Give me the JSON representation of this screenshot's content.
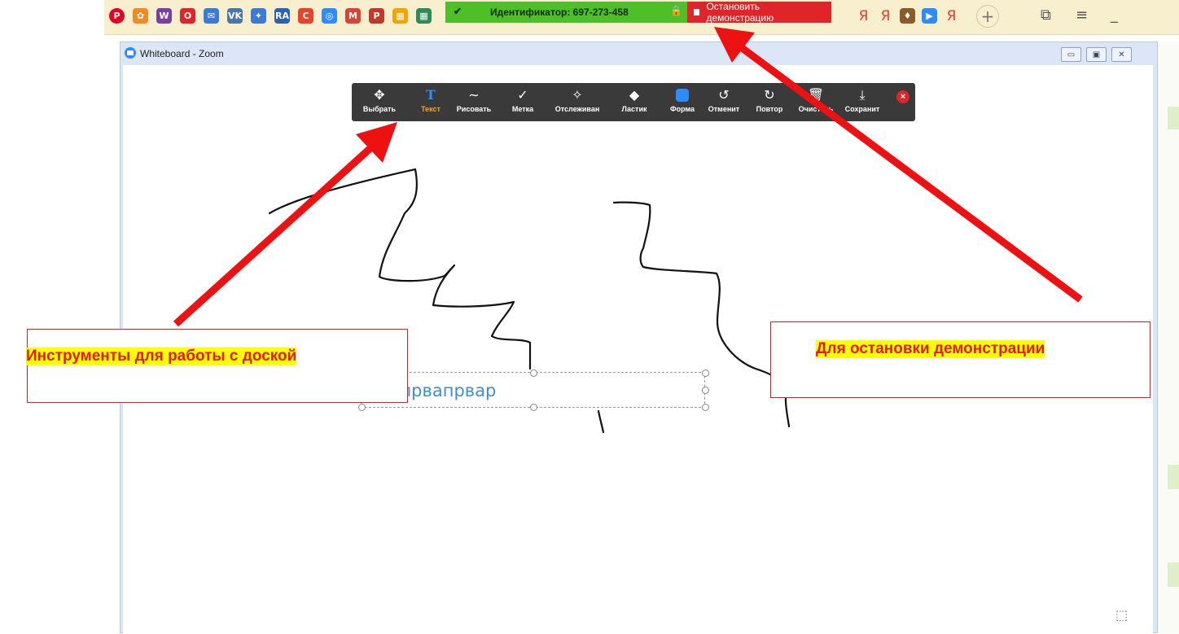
{
  "browser": {
    "bookmarks": [
      {
        "name": "pinterest-icon",
        "glyph": "P",
        "color": "#e60023",
        "round": true
      },
      {
        "name": "fish-icon",
        "glyph": "✿",
        "color": "#f08a24"
      },
      {
        "name": "w-bookmark-icon",
        "glyph": "W",
        "color": "#7b3fa0"
      },
      {
        "name": "o-bookmark-icon",
        "glyph": "O",
        "color": "#e0252a"
      },
      {
        "name": "vk-mail-icon",
        "glyph": "✉",
        "color": "#3a7bd5"
      },
      {
        "name": "vk-icon",
        "glyph": "VK",
        "color": "#4a76a8"
      },
      {
        "name": "puzzle-icon",
        "glyph": "✦",
        "color": "#3a7bd5"
      },
      {
        "name": "ra-icon",
        "glyph": "RA",
        "color": "#2a63b8"
      },
      {
        "name": "c-bookmark-icon",
        "glyph": "C",
        "color": "#e8412c"
      },
      {
        "name": "circle-icon",
        "glyph": "◎",
        "color": "#2d8cff"
      },
      {
        "name": "gmail-icon",
        "glyph": "M",
        "color": "#d44638"
      },
      {
        "name": "pdf-icon",
        "glyph": "P",
        "color": "#c0392b"
      },
      {
        "name": "grid-icon",
        "glyph": "▦",
        "color": "#f0a500"
      },
      {
        "name": "windows-icon",
        "glyph": "▦",
        "color": "#2e8b57"
      }
    ],
    "bookmarks_right": [
      {
        "name": "yandex-icon-1",
        "glyph": "Я"
      },
      {
        "name": "yandex-icon-2",
        "glyph": "Я"
      },
      {
        "name": "bird-icon",
        "glyph": "♦",
        "color": "#8a5a2b"
      },
      {
        "name": "zoom-bookmark-icon",
        "glyph": "▶",
        "color": "#2d8cff"
      },
      {
        "name": "yandex-icon-3",
        "glyph": "Я"
      }
    ],
    "plus": "+",
    "tabs_btn": "⧉",
    "menu_btn": "≡",
    "minimize_btn": "_"
  },
  "sharing": {
    "meeting_id": "Идентификатор: 697-273-458",
    "stop_label": "Остановить демонстрацию"
  },
  "window": {
    "title": "Whiteboard - Zoom",
    "controls": [
      "▭",
      "▣",
      "✕"
    ]
  },
  "toolbar": {
    "tools": [
      {
        "name": "tool-select",
        "icon": "✥",
        "label": "Выбрать"
      },
      {
        "name": "tool-text",
        "icon": "T",
        "label": "Текст",
        "active": true
      },
      {
        "name": "tool-draw",
        "icon": "∼",
        "label": "Рисовать"
      },
      {
        "name": "tool-stamp",
        "icon": "✓",
        "label": "Метка"
      },
      {
        "name": "tool-spotlight",
        "icon": "✧",
        "label": "Отслеживан"
      },
      {
        "name": "tool-eraser",
        "icon": "◆",
        "label": "Ластик"
      },
      {
        "name": "tool-shape",
        "icon": "shape",
        "label": "Форма"
      },
      {
        "name": "tool-undo",
        "icon": "↺",
        "label": "Отменит"
      },
      {
        "name": "tool-redo",
        "icon": "↻",
        "label": "Повтор"
      },
      {
        "name": "tool-clear",
        "icon": "🗑",
        "label": "Очистить"
      },
      {
        "name": "tool-save",
        "icon": "⤓",
        "label": "Сохранит"
      }
    ],
    "close": "×"
  },
  "whiteboard": {
    "text_value": "поапрвапрвар"
  },
  "annotations": {
    "left": "Инструменты для работы с доской",
    "right": "Для остановки демонстрации"
  },
  "colors": {
    "arrow": "#ee1111",
    "share_green": "#4fbf29",
    "share_red": "#e0252a",
    "accent": "#2d8cff"
  }
}
